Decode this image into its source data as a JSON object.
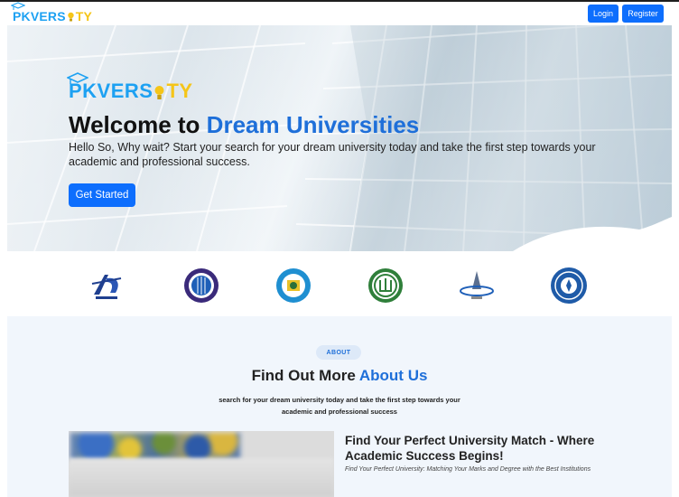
{
  "brand": {
    "part1": "PKVERS",
    "part2": "TY"
  },
  "nav": {
    "login_label": "Login",
    "register_label": "Register"
  },
  "hero": {
    "logo_part1": "PKVERS",
    "logo_part2": "TY",
    "title_prefix": "Welcome to ",
    "title_accent": "Dream Universities",
    "subtitle": "Hello So, Why wait? Start your search for your dream university today and take the first step towards your academic and professional success.",
    "cta_label": "Get Started"
  },
  "logos": [
    "au-university-logo",
    "university-seal-logo",
    "arabic-university-logo",
    "islamic-university-logo",
    "paal-logo",
    "university-crest-logo"
  ],
  "about": {
    "badge": "ABOUT",
    "title_prefix": "Find Out More ",
    "title_accent": "About Us",
    "description": "search for your dream university today and take the first step towards your academic and professional success",
    "heading": "Find Your Perfect University Match - Where Academic Success Begins!",
    "tagline": "Find Your Perfect University: Matching Your Marks and Degree with the Best Institutions"
  },
  "colors": {
    "primary": "#0d6efd",
    "accent_blue": "#1e6fd9",
    "brand_blue": "#1da1f2",
    "brand_yellow": "#f5c518",
    "section_bg": "#f1f6fc"
  }
}
